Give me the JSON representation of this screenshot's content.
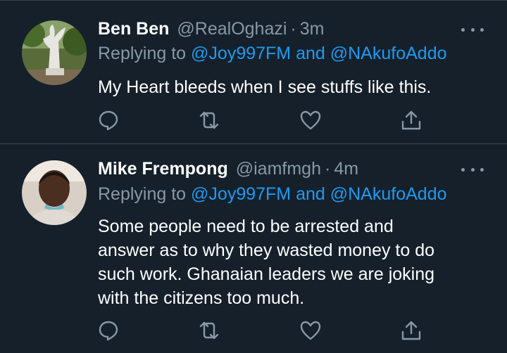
{
  "tweets": [
    {
      "name": "Ben Ben",
      "handle": "@RealOghazi",
      "separator": "·",
      "time": "3m",
      "replying_prefix": "Replying to",
      "mention1": "@Joy997FM",
      "mention_joiner": "and",
      "mention2": "@NAkufoAddo",
      "text": "My Heart bleeds when I see stuffs like this.",
      "avatar": "statue-photo",
      "icons": [
        "reply-icon",
        "retweet-icon",
        "like-icon",
        "share-icon",
        "more-icon"
      ]
    },
    {
      "name": "Mike Frempong",
      "handle": "@iamfmgh",
      "separator": "·",
      "time": "4m",
      "replying_prefix": "Replying to",
      "mention1": "@Joy997FM",
      "mention_joiner": "and",
      "mention2": "@NAkufoAddo",
      "text": "Some people need to be arrested and\nanswer as to why they wasted money to do\nsuch work. Ghanaian leaders we are joking\nwith the citizens too much.",
      "avatar": "man-photo",
      "icons": [
        "reply-icon",
        "retweet-icon",
        "like-icon",
        "share-icon",
        "more-icon"
      ]
    }
  ],
  "colors": {
    "background": "#15202b",
    "text": "#ffffff",
    "secondary": "#8899a6",
    "link": "#1d9bf0",
    "divider": "#38444d"
  }
}
